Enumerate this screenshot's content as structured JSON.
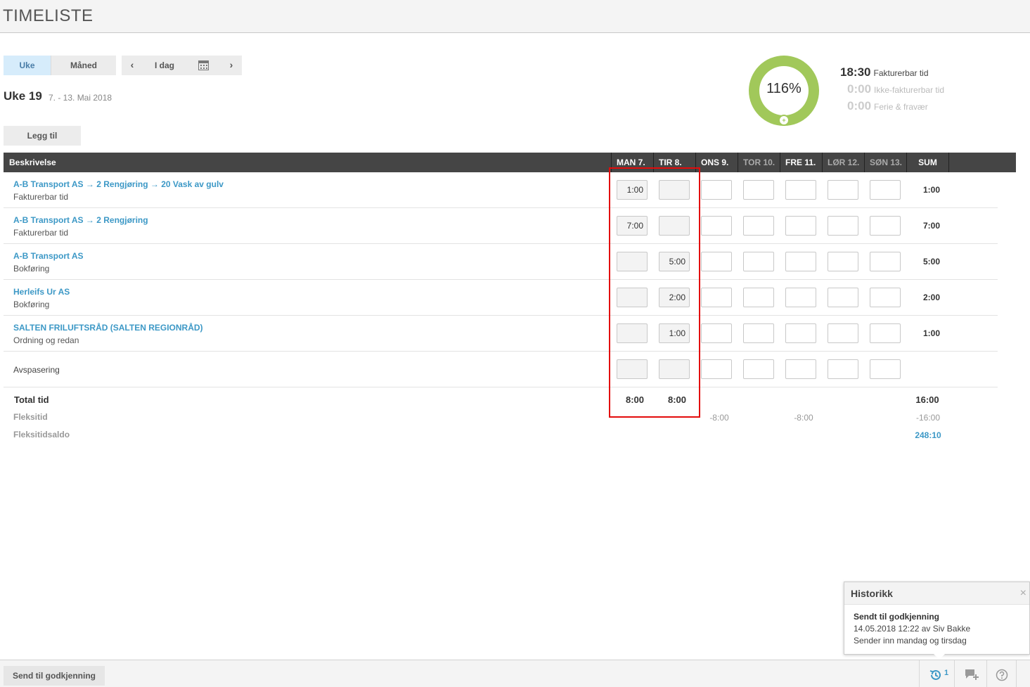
{
  "header": {
    "title": "TIMELISTE"
  },
  "view_toggle": {
    "week": "Uke",
    "month": "Måned"
  },
  "nav": {
    "prev": "‹",
    "today": "I dag",
    "next": "›"
  },
  "period": {
    "week": "Uke 19",
    "range": "7. - 13. Mai 2018"
  },
  "add_button": "Legg til",
  "summary": {
    "percent": "116%",
    "billable": {
      "value": "18:30",
      "label": "Fakturerbar tid"
    },
    "nonbillable": {
      "value": "0:00",
      "label": "Ikke-fakturerbar tid"
    },
    "vacation": {
      "value": "0:00",
      "label": "Ferie & fravær"
    },
    "ring_color": "#a1c85a"
  },
  "table": {
    "desc_header": "Beskrivelse",
    "days": [
      "MAN 7.",
      "TIR 8.",
      "ONS 9.",
      "TOR 10.",
      "FRE 11.",
      "LØR 12.",
      "SØN 13."
    ],
    "sum_header": "SUM",
    "rows": [
      {
        "title": "A-B Transport AS → 2 Rengjøring → 20 Vask av gulv",
        "sub": "Fakturerbar tid",
        "values": [
          "1:00",
          "",
          "",
          "",
          "",
          "",
          ""
        ],
        "sum": "1:00"
      },
      {
        "title": "A-B Transport AS → 2 Rengjøring",
        "sub": "Fakturerbar tid",
        "values": [
          "7:00",
          "",
          "",
          "",
          "",
          "",
          ""
        ],
        "sum": "7:00"
      },
      {
        "title": "A-B Transport AS",
        "sub": "Bokføring",
        "values": [
          "",
          "5:00",
          "",
          "",
          "",
          "",
          ""
        ],
        "sum": "5:00"
      },
      {
        "title": "Herleifs Ur AS",
        "sub": "Bokføring",
        "values": [
          "",
          "2:00",
          "",
          "",
          "",
          "",
          ""
        ],
        "sum": "2:00"
      },
      {
        "title": "SALTEN FRILUFTSRÅD (SALTEN REGIONRÅD)",
        "sub": "Ordning og redan",
        "values": [
          "",
          "1:00",
          "",
          "",
          "",
          "",
          ""
        ],
        "sum": "1:00"
      },
      {
        "title": "Avspasering",
        "values": [
          "",
          "",
          "",
          "",
          "",
          "",
          ""
        ],
        "sum": ""
      }
    ],
    "total": {
      "label": "Total tid",
      "mon": "8:00",
      "tue": "8:00",
      "sum": "16:00"
    },
    "flex": {
      "label": "Fleksitid",
      "wed": "-8:00",
      "fri": "-8:00",
      "sum": "-16:00"
    },
    "saldo": {
      "label": "Fleksitidsaldo",
      "sum": "248:10"
    }
  },
  "history_popup": {
    "title": "Historikk",
    "close": "×",
    "status": "Sendt til godkjenning",
    "meta": "14.05.2018 12:22 av Siv Bakke",
    "comment": "Sender inn mandag og tirsdag"
  },
  "footer": {
    "send_button": "Send til godkjenning",
    "history_count": "1"
  },
  "colors": {
    "link": "#3c98c6",
    "highlight": "#e30b0b",
    "accent_tab": "#d6ecfb"
  }
}
